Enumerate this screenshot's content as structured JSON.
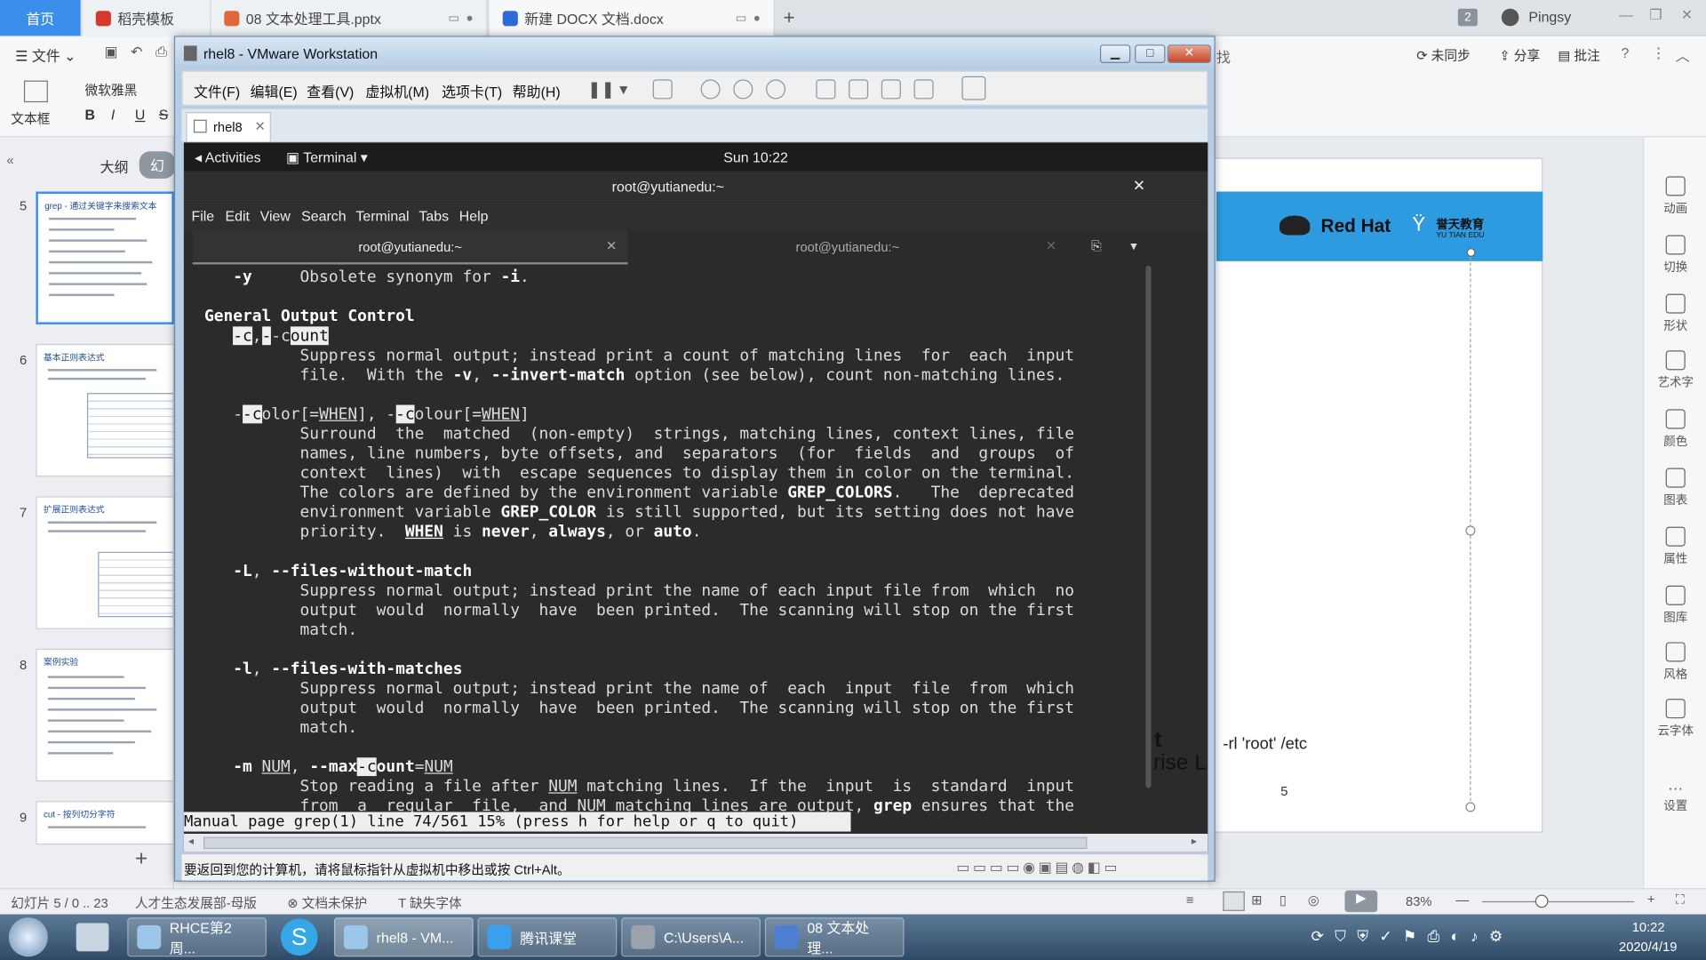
{
  "wps": {
    "home_tab": "首页",
    "tabs": [
      {
        "label": "稻壳模板"
      },
      {
        "label": "08 文本处理工具.pptx"
      },
      {
        "label": "新建 DOCX 文档.docx"
      }
    ],
    "add_tab": "+",
    "page_count_badge": "2",
    "user": "Pingsy",
    "file_menu": "文件",
    "font_name": "微软雅黑",
    "textbox_label": "文本框",
    "sync": "未同步",
    "share": "分享",
    "comment": "批注",
    "find_partial": "找",
    "outline_tab": "大纲",
    "slides_tab": "幻",
    "slides": [
      {
        "num": "5",
        "title": "grep - 通过关键字来搜索文本"
      },
      {
        "num": "6",
        "title": "基本正则表达式"
      },
      {
        "num": "7",
        "title": "扩展正则表达式"
      },
      {
        "num": "8",
        "title": "案例实验"
      },
      {
        "num": "9",
        "title": "cut - 按列切分字符"
      }
    ],
    "slide_texts": {
      "command_partial": "-rl 'root' /etc",
      "page_number": "5",
      "big_t": "t",
      "rise_partial": "rise L",
      "redhat": "Red Hat",
      "yutian": "誉天教育",
      "yutian_en": "YU TIAN EDU"
    },
    "right_tools": [
      "动画",
      "切换",
      "形状",
      "艺术字",
      "颜色",
      "图表",
      "属性",
      "图库",
      "风格",
      "云字体",
      "设置"
    ],
    "status": {
      "slide_info": "幻灯片 5 / 0 .. 23",
      "template": "人才生态发展部-母版",
      "protect": "文档未保护",
      "missing_font": "缺失字体",
      "zoom": "83%"
    }
  },
  "taskbar": {
    "items": [
      "RHCE第2周...",
      "rhel8 - VM...",
      "腾讯课堂",
      "C:\\Users\\A...",
      "08 文本处理..."
    ],
    "time": "10:22",
    "date": "2020/4/19"
  },
  "vmware": {
    "title": "rhel8 - VMware Workstation",
    "menu": [
      "文件(F)",
      "编辑(E)",
      "查看(V)",
      "虚拟机(M)",
      "选项卡(T)",
      "帮助(H)"
    ],
    "tab": "rhel8",
    "status_text": "要返回到您的计算机，请将鼠标指针从虚拟机中移出或按 Ctrl+Alt。"
  },
  "guest": {
    "activities": "Activities",
    "terminal_menu": "Terminal",
    "clock": "Sun 10:22",
    "window_title": "root@yutianedu:~",
    "menu": [
      "File",
      "Edit",
      "View",
      "Search",
      "Terminal",
      "Tabs",
      "Help"
    ],
    "tabs": [
      "root@yutianedu:~",
      "root@yutianedu:~"
    ],
    "man_status": "Manual page grep(1) line 74/561 15% (press h for help or q to quit)"
  }
}
